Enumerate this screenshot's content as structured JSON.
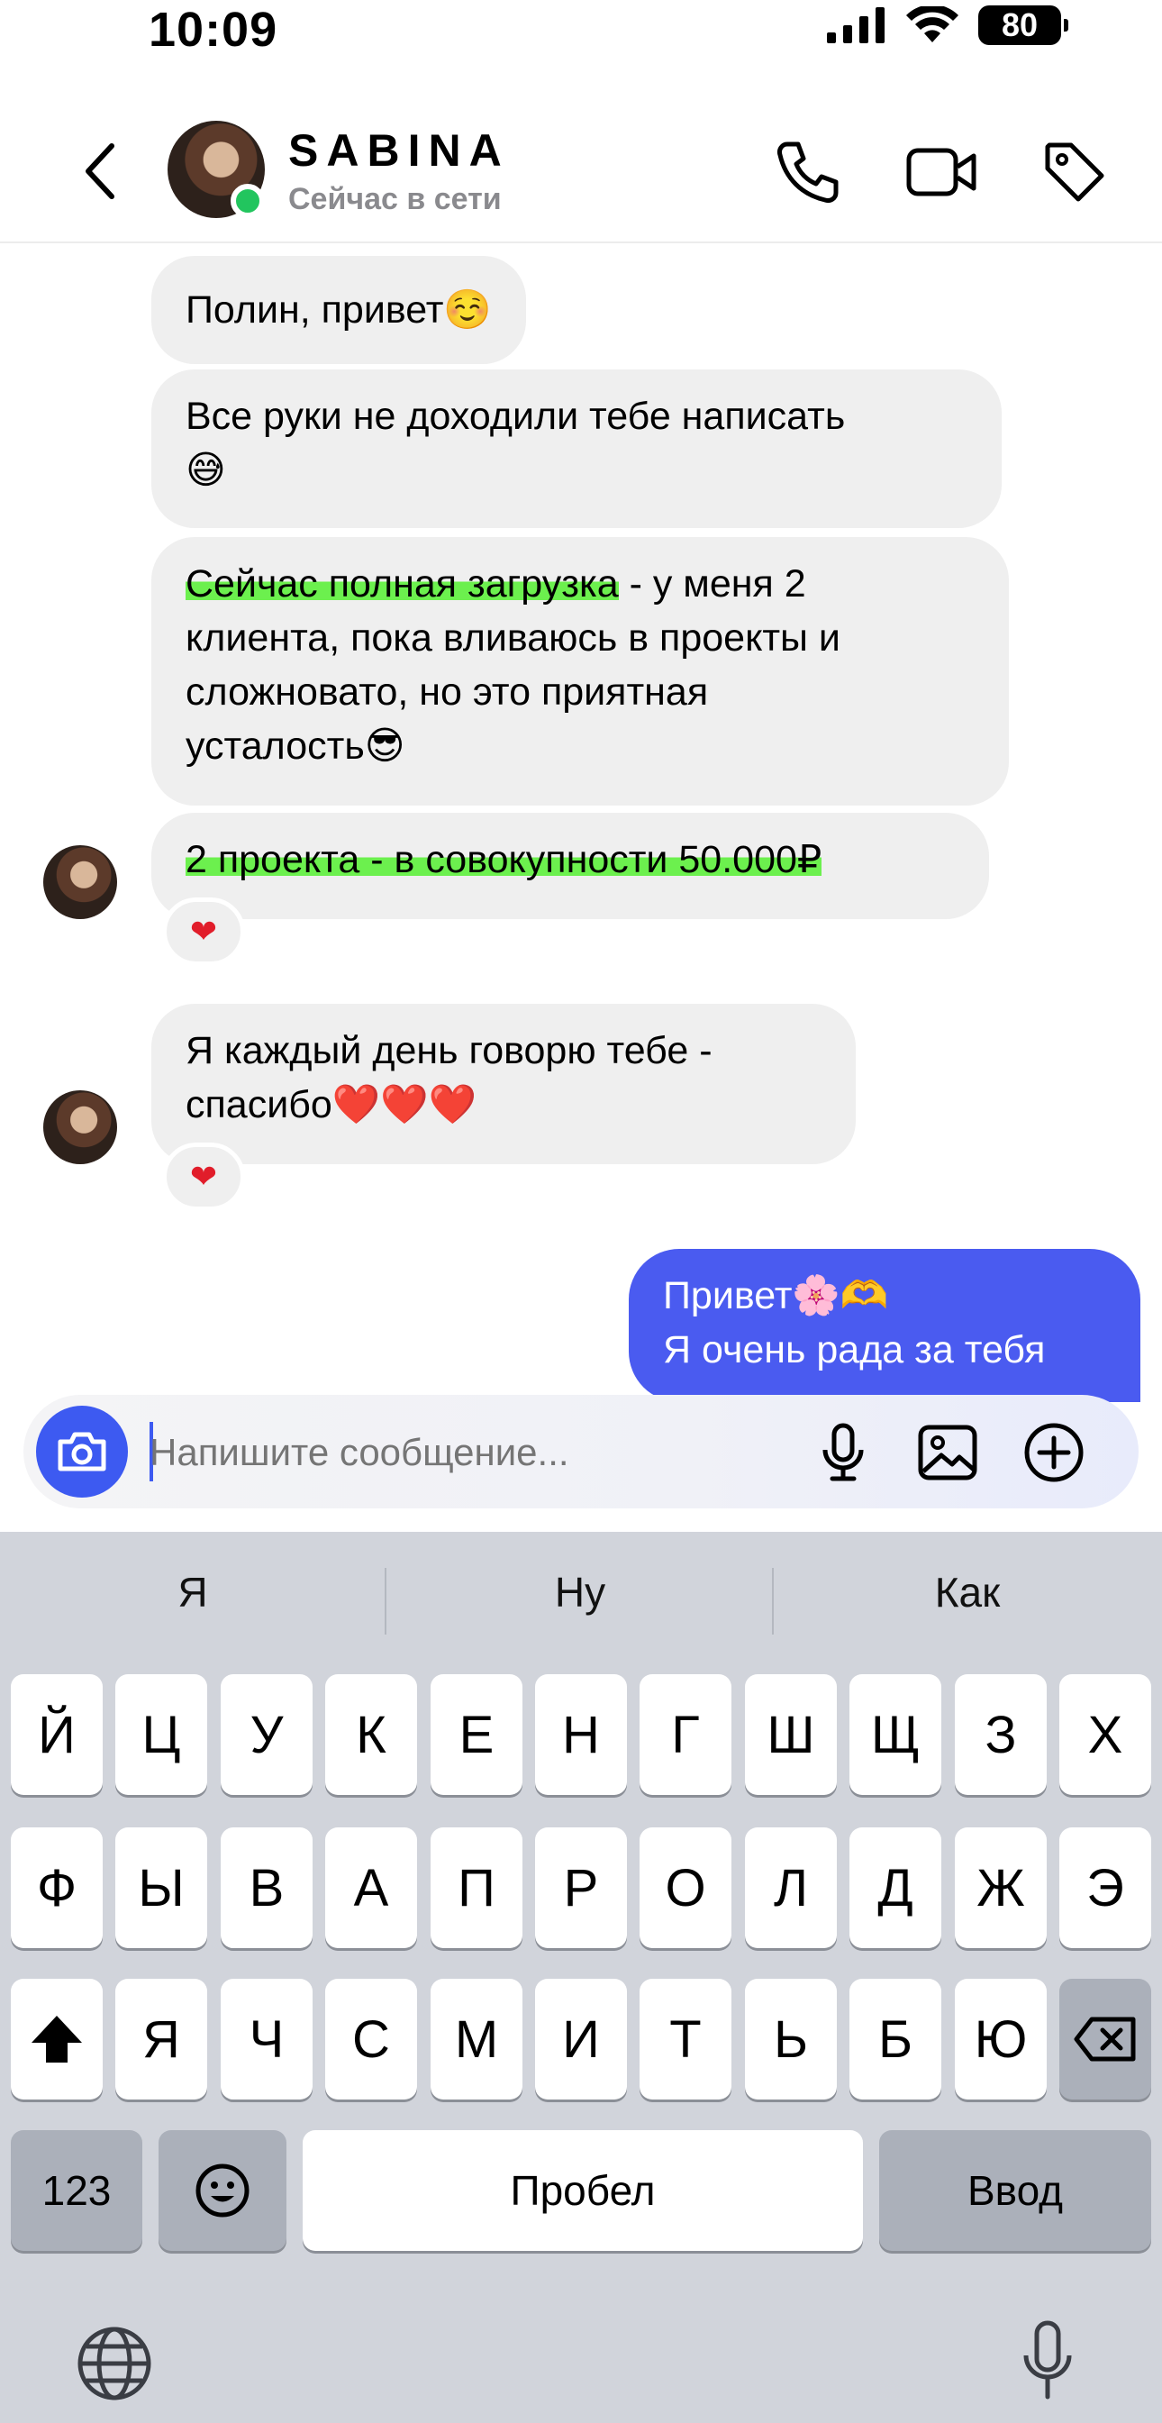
{
  "status_bar": {
    "time": "10:09",
    "battery": "80"
  },
  "header": {
    "name": "SABINA",
    "status": "Сейчас в сети"
  },
  "messages": [
    {
      "text": "Полин, привет☺️"
    },
    {
      "line1": "Все руки не доходили тебе написать",
      "line2": "😅"
    },
    {
      "line1_hl": "Сейчас полная загрузка",
      "line1_rest": " - у меня 2",
      "line2": "клиента, пока вливаюсь в проекты и",
      "line3": "сложновато, но это приятная",
      "line4": "усталость😎"
    },
    {
      "text_hl": "2 проекта - в совокупности 50.000₽",
      "reaction": "❤"
    },
    {
      "line1": "Я каждый день говорю тебе -",
      "line2": "спасибо❤️❤️❤️",
      "reaction": "❤"
    },
    {
      "line1": "Привет🌸🫶",
      "line2": "Я очень рада за тебя"
    }
  ],
  "composer": {
    "placeholder": "Напишите сообщение..."
  },
  "keyboard": {
    "suggestions": [
      "Я",
      "Ну",
      "Как"
    ],
    "row1": [
      "Й",
      "Ц",
      "У",
      "К",
      "Е",
      "Н",
      "Г",
      "Ш",
      "Щ",
      "З",
      "Х"
    ],
    "row2": [
      "Ф",
      "Ы",
      "В",
      "А",
      "П",
      "Р",
      "О",
      "Л",
      "Д",
      "Ж",
      "Э"
    ],
    "row3": [
      "Я",
      "Ч",
      "С",
      "М",
      "И",
      "Т",
      "Ь",
      "Б",
      "Ю"
    ],
    "numbers_label": "123",
    "space_label": "Пробел",
    "return_label": "Ввод"
  },
  "icons": {
    "back": "chevron-left-icon",
    "phone": "phone-icon",
    "video": "video-camera-icon",
    "tag": "tag-icon",
    "camera": "camera-icon",
    "mic": "microphone-icon",
    "gallery": "image-icon",
    "plus": "plus-circle-icon",
    "shift": "shift-icon",
    "delete": "backspace-icon",
    "emoji": "emoji-icon",
    "globe": "globe-icon",
    "dictation": "microphone-icon"
  },
  "colors": {
    "outgoing": "#4a5bf0",
    "incoming": "#efefef",
    "highlight": "#6cf04e",
    "online": "#22c55e",
    "accent": "#3d5af1"
  }
}
